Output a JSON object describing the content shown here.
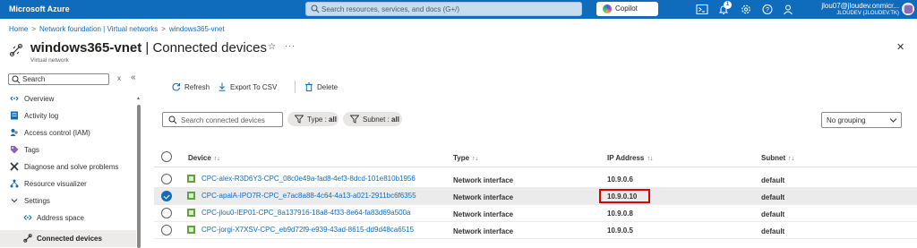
{
  "topbar": {
    "brand": "Microsoft Azure",
    "search_placeholder": "Search resources, services, and docs (G+/)",
    "copilot_label": "Copilot",
    "notification_count": "1",
    "account_user": "jlou07@jloudev.onmicr...",
    "account_tenant": "JLOUDEV (JLOUDEV.TK)",
    "icons": [
      "cloud-shell-icon",
      "bell-icon",
      "gear-icon",
      "help-icon",
      "feedback-icon"
    ]
  },
  "breadcrumb": {
    "items": [
      "Home",
      "Network foundation | Virtual networks",
      "windows365-vnet"
    ],
    "separator": ">"
  },
  "header": {
    "resource_name": "windows365-vnet",
    "separator": " | ",
    "page_name": "Connected devices",
    "subtitle": "Virtual network",
    "star": "☆",
    "more": "···",
    "close": "✕"
  },
  "sidebar": {
    "search_placeholder": "Search",
    "clear": "x",
    "collapse": "«",
    "items": [
      {
        "label": "Overview",
        "icon": "overview-icon",
        "level": 0,
        "active": false
      },
      {
        "label": "Activity log",
        "icon": "activity-log-icon",
        "level": 0,
        "active": false
      },
      {
        "label": "Access control (IAM)",
        "icon": "iam-icon",
        "level": 0,
        "active": false
      },
      {
        "label": "Tags",
        "icon": "tag-icon",
        "level": 0,
        "active": false
      },
      {
        "label": "Diagnose and solve problems",
        "icon": "diagnose-icon",
        "level": 0,
        "active": false
      },
      {
        "label": "Resource visualizer",
        "icon": "visualizer-icon",
        "level": 0,
        "active": false
      },
      {
        "label": "Settings",
        "icon": "chevron-down-icon",
        "level": 0,
        "active": false
      },
      {
        "label": "Address space",
        "icon": "address-space-icon",
        "level": 1,
        "active": false
      },
      {
        "label": "Connected devices",
        "icon": "connected-devices-icon",
        "level": 1,
        "active": true
      }
    ]
  },
  "toolbar": {
    "refresh_label": "Refresh",
    "export_label": "Export To CSV",
    "delete_label": "Delete"
  },
  "filters": {
    "search_placeholder": "Search connected devices",
    "type_filter": {
      "key": "Type : ",
      "value": "all"
    },
    "subnet_filter": {
      "key": "Subnet : ",
      "value": "all"
    },
    "grouping": "No grouping"
  },
  "table": {
    "columns": [
      "Device",
      "Type",
      "IP Address",
      "Subnet"
    ],
    "sort_glyph": "↑↓",
    "rows": [
      {
        "device": "CPC-alex-R3D6Y3-CPC_08c0e49a-fad8-4ef3-8dcd-101e810b1956",
        "type": "Network interface",
        "ip": "10.9.0.6",
        "subnet": "default",
        "selected": false
      },
      {
        "device": "CPC-apalA-IPO7R-CPC_e7ac8a88-4c64-4a13-a021-2911bc6f6355",
        "type": "Network interface",
        "ip": "10.9.0.10",
        "subnet": "default",
        "selected": true
      },
      {
        "device": "CPC-jlou0-IEP01-CPC_8a137916-18a8-4f33-8e64-fa83d69a500a",
        "type": "Network interface",
        "ip": "10.9.0.8",
        "subnet": "default",
        "selected": false
      },
      {
        "device": "CPC-jorgi-X7XSV-CPC_eb9d72f9-e939-43ad-8615-dd9d48ca6515",
        "type": "Network interface",
        "ip": "10.9.0.5",
        "subnet": "default",
        "selected": false
      }
    ]
  },
  "colors": {
    "accent": "#0f6cbd",
    "highlight_box": "#e00000",
    "selected_row": "#ebebeb"
  }
}
